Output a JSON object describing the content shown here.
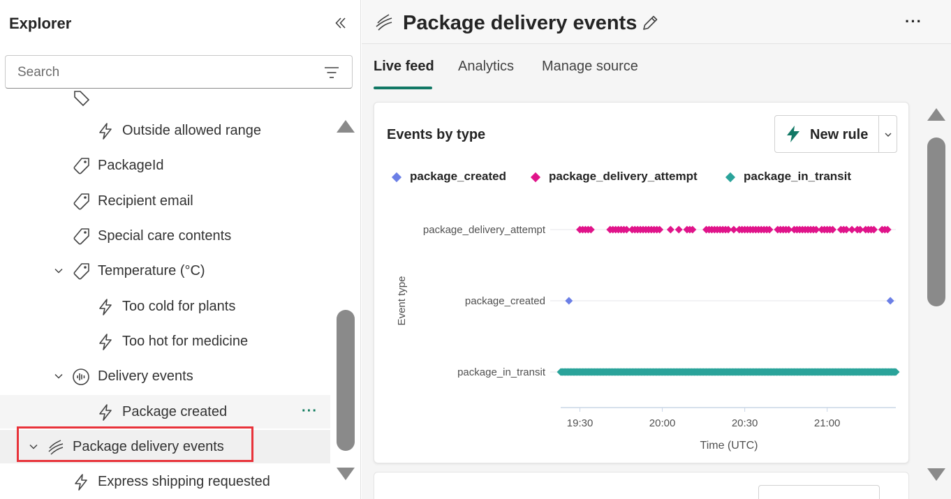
{
  "explorer": {
    "title": "Explorer",
    "search_placeholder": "Search",
    "items": [
      {
        "label": "Outside allowed range",
        "icon": "lightning-icon",
        "level": 2
      },
      {
        "label": "PackageId",
        "icon": "tag-icon",
        "level": 1
      },
      {
        "label": "Recipient email",
        "icon": "tag-icon",
        "level": 1
      },
      {
        "label": "Special care contents",
        "icon": "tag-icon",
        "level": 1
      },
      {
        "label": "Temperature (°C)",
        "icon": "tag-icon",
        "level": 1,
        "expanded": true
      },
      {
        "label": "Too cold for plants",
        "icon": "lightning-icon",
        "level": 2
      },
      {
        "label": "Too hot for medicine",
        "icon": "lightning-icon",
        "level": 2
      },
      {
        "label": "Delivery events",
        "icon": "event-icon",
        "level": 1,
        "expanded": true
      },
      {
        "label": "Package created",
        "icon": "lightning-icon",
        "level": 2,
        "hover": true
      },
      {
        "label": "Package delivery events",
        "icon": "stream-icon",
        "level": 0,
        "expanded": true,
        "selected": true
      },
      {
        "label": "Express shipping requested",
        "icon": "lightning-icon",
        "level": 1
      }
    ],
    "row_more": "···"
  },
  "header": {
    "title": "Package delivery events",
    "more": "···"
  },
  "tabs": [
    {
      "label": "Live feed",
      "active": true
    },
    {
      "label": "Analytics",
      "active": false
    },
    {
      "label": "Manage source",
      "active": false
    }
  ],
  "card": {
    "title": "Events by type",
    "new_rule_label": "New rule"
  },
  "colors": {
    "package_created": "#6b7fe6",
    "package_delivery_attempt": "#e0148a",
    "package_in_transit": "#2aa39a",
    "accent": "#117865",
    "highlight": "#e8333a"
  },
  "chart_data": {
    "type": "scatter",
    "ylabel": "Event type",
    "xlabel": "Time (UTC)",
    "x_ticks": [
      "19:30",
      "20:00",
      "20:30",
      "21:00"
    ],
    "x_tick_minutes": [
      1170,
      1200,
      1230,
      1260
    ],
    "xlim_minutes": [
      1163,
      1285
    ],
    "categories": [
      "package_delivery_attempt",
      "package_created",
      "package_in_transit"
    ],
    "legend": [
      "package_created",
      "package_delivery_attempt",
      "package_in_transit"
    ],
    "series": [
      {
        "name": "package_created",
        "category": "package_created",
        "minutes": [
          1166,
          1283
        ]
      },
      {
        "name": "package_delivery_attempt",
        "category": "package_delivery_attempt",
        "minutes": [
          1170,
          1171,
          1172,
          1173,
          1174,
          1181,
          1182,
          1183,
          1184,
          1185,
          1186,
          1187,
          1189,
          1190,
          1191,
          1192,
          1193,
          1194,
          1195,
          1196,
          1197,
          1198,
          1199,
          1203,
          1206,
          1209,
          1210,
          1211,
          1216,
          1217,
          1218,
          1219,
          1220,
          1221,
          1222,
          1223,
          1224,
          1226,
          1228,
          1229,
          1230,
          1231,
          1232,
          1233,
          1234,
          1235,
          1236,
          1237,
          1238,
          1239,
          1242,
          1243,
          1244,
          1245,
          1246,
          1248,
          1249,
          1250,
          1251,
          1252,
          1253,
          1254,
          1255,
          1256,
          1258,
          1259,
          1260,
          1261,
          1262,
          1265,
          1266,
          1267,
          1269,
          1271,
          1272,
          1274,
          1275,
          1276,
          1277,
          1280,
          1281,
          1282
        ]
      },
      {
        "name": "package_in_transit",
        "category": "package_in_transit",
        "range_minutes": [
          1163,
          1285
        ],
        "density_per_minute": 3
      }
    ]
  }
}
